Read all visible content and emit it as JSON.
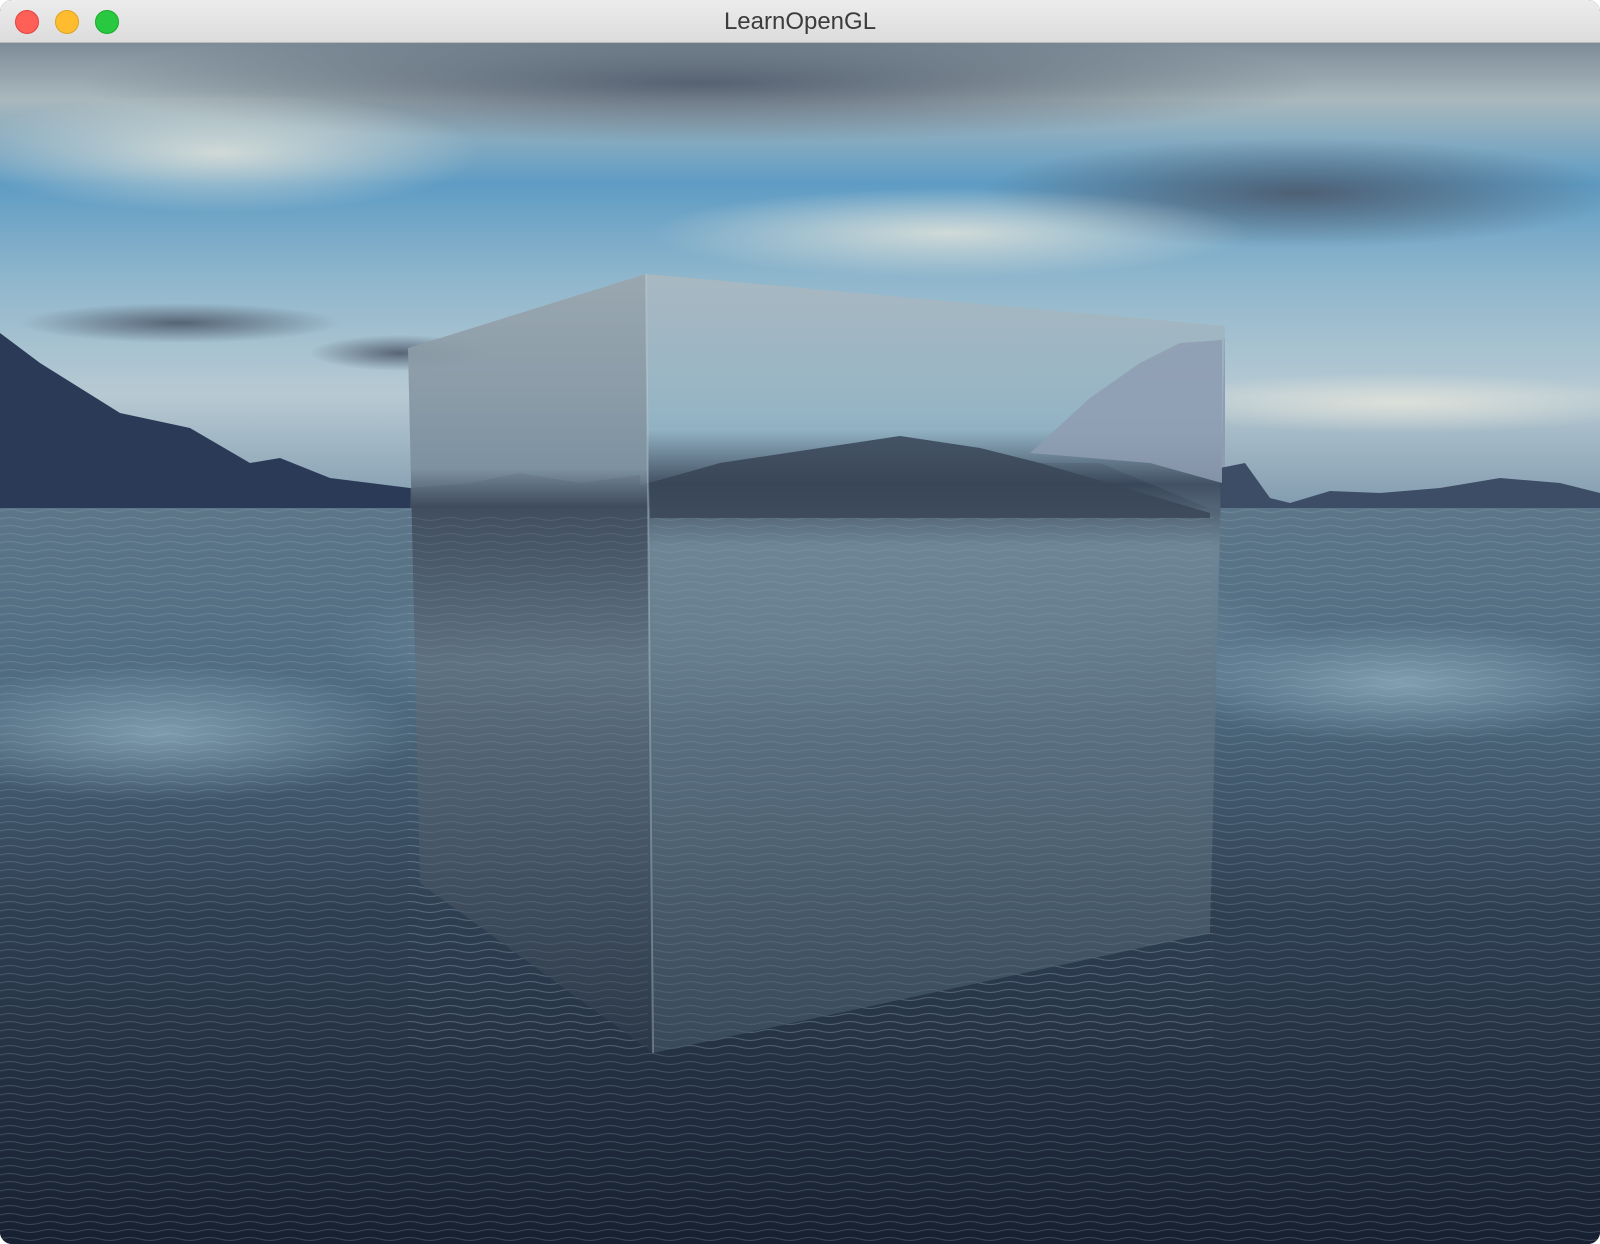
{
  "window": {
    "title": "LearnOpenGL",
    "controls": {
      "close_color": "#fe5f57",
      "minimize_color": "#febc2e",
      "zoom_color": "#28c840"
    }
  },
  "scene": {
    "description_icons": [
      "skybox-sky",
      "skybox-mountains",
      "skybox-ocean",
      "reflective-cube"
    ],
    "colors": {
      "sky_top": "#8c9aa6",
      "sky_mid": "#6fa6c8",
      "horizon": "#c5d6de",
      "mountain": "#2b3a57",
      "ocean_near": "#1b2535",
      "ocean_far": "#6f8aa0"
    }
  }
}
